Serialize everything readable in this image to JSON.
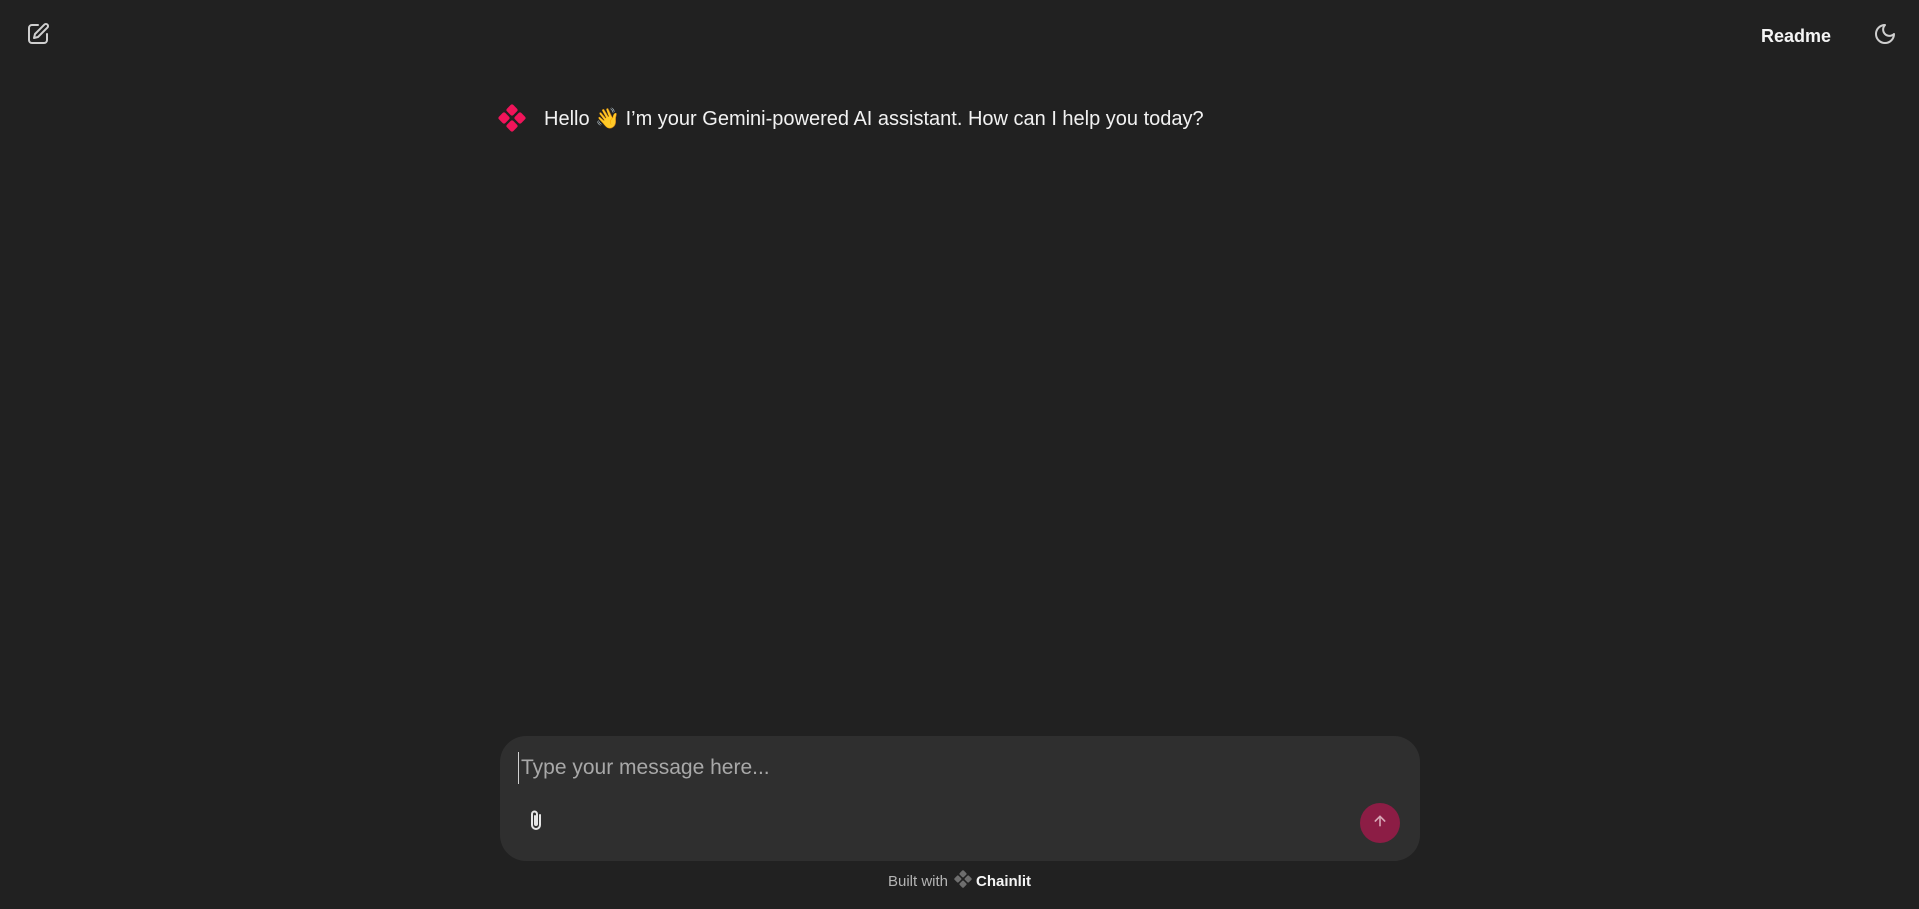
{
  "header": {
    "new_chat_icon": "edit-icon",
    "readme_label": "Readme",
    "theme_icon": "moon-icon"
  },
  "messages": [
    {
      "author": "assistant",
      "avatar_icon": "chainlit-logo-icon",
      "text": "Hello 👋 I’m your Gemini-powered AI assistant. How can I help you today?"
    }
  ],
  "composer": {
    "placeholder": "Type your message here...",
    "value": "",
    "attach_icon": "paperclip-icon",
    "send_icon": "arrow-up-icon"
  },
  "footer": {
    "built_with": "Built with",
    "brand": "Chainlit"
  },
  "colors": {
    "background": "#212121",
    "composer_bg": "#2f2f2f",
    "accent": "#f0145a",
    "send_button": "#8c1d45"
  }
}
